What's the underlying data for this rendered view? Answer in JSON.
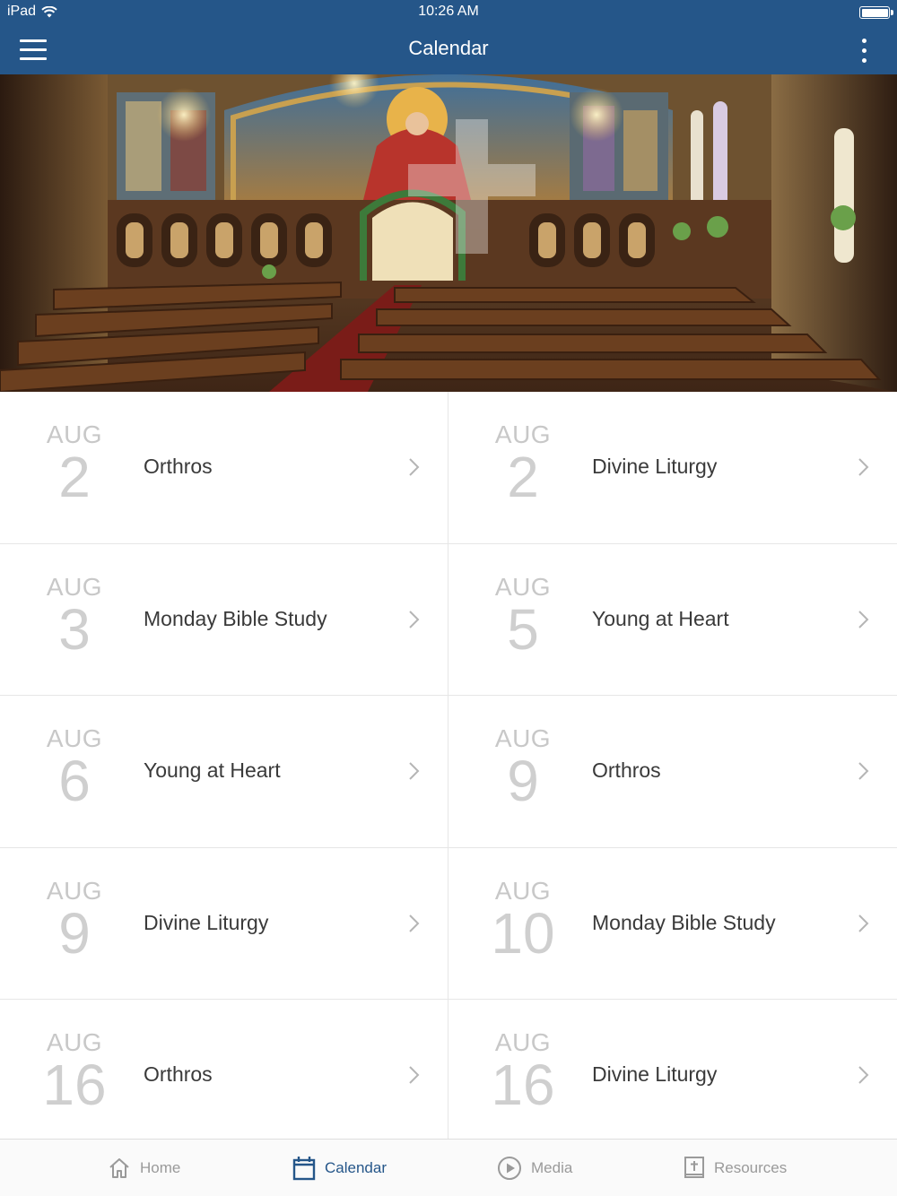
{
  "status_bar": {
    "carrier": "iPad",
    "time": "10:26 AM"
  },
  "navbar": {
    "title": "Calendar"
  },
  "events": [
    {
      "month": "AUG",
      "day": "2",
      "title": "Orthros"
    },
    {
      "month": "AUG",
      "day": "2",
      "title": "Divine Liturgy"
    },
    {
      "month": "AUG",
      "day": "3",
      "title": "Monday Bible Study"
    },
    {
      "month": "AUG",
      "day": "5",
      "title": "Young at Heart"
    },
    {
      "month": "AUG",
      "day": "6",
      "title": "Young at Heart"
    },
    {
      "month": "AUG",
      "day": "9",
      "title": "Orthros"
    },
    {
      "month": "AUG",
      "day": "9",
      "title": "Divine Liturgy"
    },
    {
      "month": "AUG",
      "day": "10",
      "title": "Monday Bible Study"
    },
    {
      "month": "AUG",
      "day": "16",
      "title": "Orthros"
    },
    {
      "month": "AUG",
      "day": "16",
      "title": "Divine Liturgy"
    }
  ],
  "tabs": [
    {
      "label": "Home",
      "icon": "home-icon",
      "active": false
    },
    {
      "label": "Calendar",
      "icon": "calendar-icon",
      "active": true
    },
    {
      "label": "Media",
      "icon": "play-circle-icon",
      "active": false
    },
    {
      "label": "Resources",
      "icon": "book-cross-icon",
      "active": false
    }
  ],
  "colors": {
    "header": "#255689",
    "accent": "#255689",
    "muted": "#9a9a9a"
  }
}
